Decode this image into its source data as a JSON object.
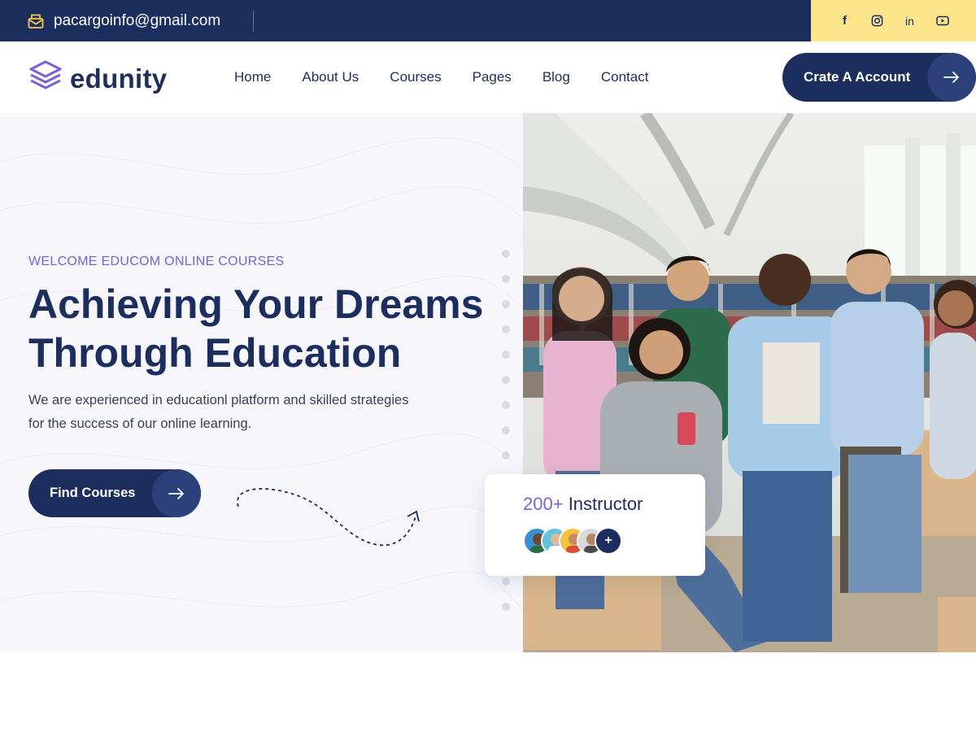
{
  "topbar": {
    "email": "pacargoinfo@gmail.com",
    "social": [
      {
        "icon": "facebook-icon",
        "glyph": "f"
      },
      {
        "icon": "instagram-icon",
        "glyph": ""
      },
      {
        "icon": "linkedin-icon",
        "glyph": "in"
      },
      {
        "icon": "youtube-icon",
        "glyph": ""
      }
    ]
  },
  "header": {
    "logo_text": "edunity",
    "nav": [
      "Home",
      "About Us",
      "Courses",
      "Pages",
      "Blog",
      "Contact"
    ],
    "cta_label": "Crate A Account"
  },
  "hero": {
    "subtitle": "WELCOME EDUCOM ONLINE COURSES",
    "title_line1": "Achieving Your Dreams",
    "title_line2": "Through Education",
    "desc_line1": "We are experienced in educationl platform and skilled strategies",
    "desc_line2": "for the success of our online learning.",
    "button_label": "Find Courses"
  },
  "instructor_card": {
    "count": "200+",
    "label": "Instructor",
    "plus": "+"
  },
  "colors": {
    "navy": "#1c2e5e",
    "accent_purple": "#7a63d6",
    "social_bg": "#fde58b"
  }
}
